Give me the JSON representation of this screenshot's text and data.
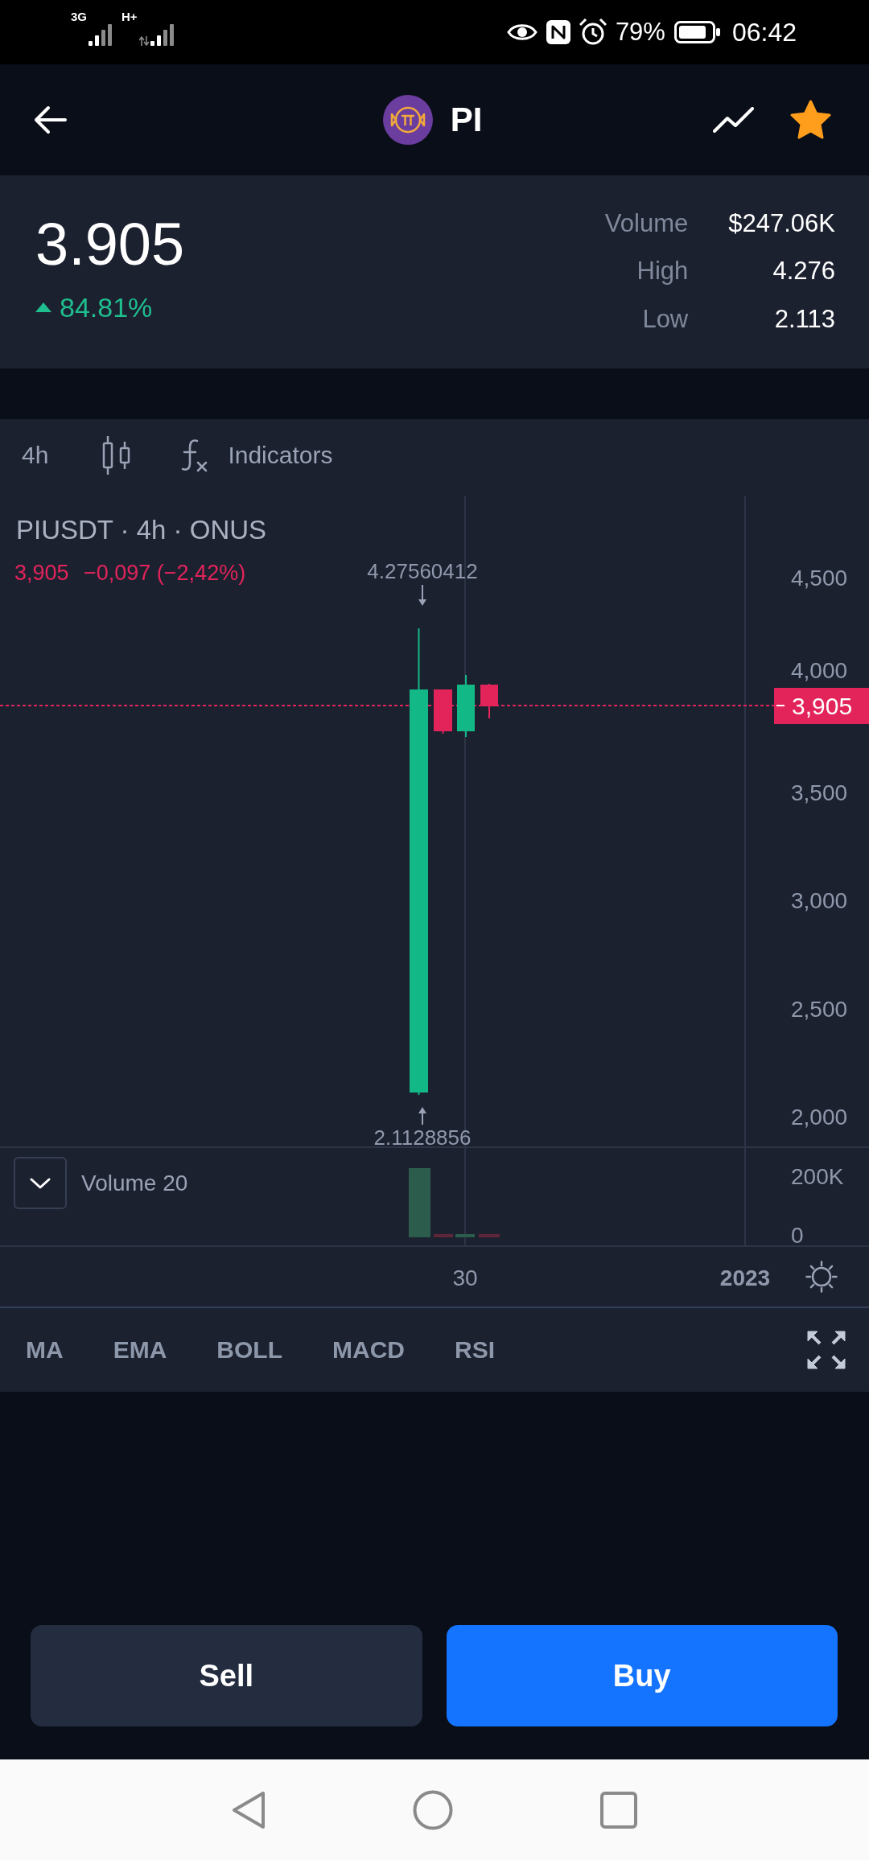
{
  "status_bar": {
    "network_1": "3G",
    "network_2": "H+",
    "battery": "79%",
    "time": "06:42"
  },
  "header": {
    "title": "PI",
    "favorite": true
  },
  "ticker": {
    "price": "3.905",
    "rising": true,
    "change": "84.81%",
    "stats": [
      {
        "label": "Volume",
        "value": "$247.06K"
      },
      {
        "label": "High",
        "value": "4.276"
      },
      {
        "label": "Low",
        "value": "2.113"
      }
    ]
  },
  "toolbar": {
    "interval": "4h",
    "indicators": "Indicators"
  },
  "chart": {
    "legend": "PIUSDT · 4h · ONUS",
    "last": "3,905",
    "change": "−0,097 (−2,42%)",
    "high_marker": "4.27560412",
    "low_marker": "2.1128856",
    "price_tag": "3,905",
    "price_axis": [
      "4,500",
      "4,000",
      "3,500",
      "3,000",
      "2,500",
      "2,000"
    ],
    "candles": [
      {
        "kind": "rising"
      },
      {
        "kind": "falling"
      },
      {
        "kind": "rising"
      },
      {
        "kind": "falling"
      }
    ],
    "volume": {
      "label": "Volume 20",
      "axis": [
        "200K",
        "0"
      ]
    },
    "time_axis": [
      "30",
      "2023"
    ]
  },
  "indicator_tabs": [
    "MA",
    "EMA",
    "BOLL",
    "MACD",
    "RSI"
  ],
  "actions": [
    {
      "label": "Sell",
      "kind": "sell"
    },
    {
      "label": "Buy",
      "kind": "buy"
    }
  ]
}
